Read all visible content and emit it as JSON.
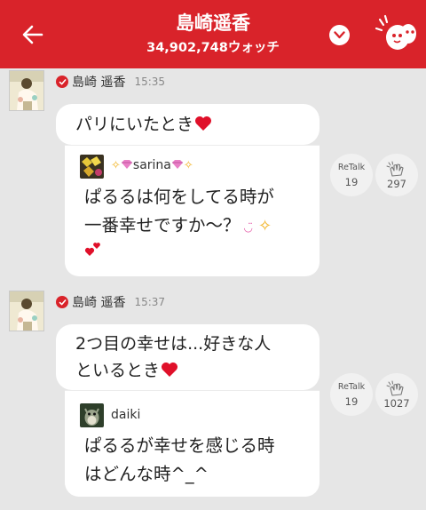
{
  "header": {
    "title": "島崎遥香",
    "subtitle": "34,902,748ウォッチ"
  },
  "posts": [
    {
      "author": "島崎 遥香",
      "time": "15:35",
      "message": "パリにいたとき",
      "quote": {
        "name": "sarina",
        "lines": [
          "ぱるるは何をしてる時が",
          "一番幸せですか〜？"
        ]
      },
      "retalk_label": "ReTalk",
      "retalk_count": "19",
      "clap_count": "297"
    },
    {
      "author": "島崎 遥香",
      "time": "15:37",
      "message_lines": [
        "2つ目の幸せは...好きな人",
        "といるとき"
      ],
      "quote": {
        "name": "daiki",
        "lines": [
          "ぱるるが幸せを感じる時",
          "はどんな時^_^"
        ]
      },
      "retalk_label": "ReTalk",
      "retalk_count": "19",
      "clap_count": "1027"
    }
  ],
  "colors": {
    "brand": "#d9232a",
    "background": "#e6e6e6",
    "heart": "#e0102a"
  },
  "icons": [
    "back-arrow-icon",
    "chevron-down-icon",
    "watch-face-icon",
    "verified-badge-icon",
    "heart-icon",
    "clap-hands-icon",
    "sparkle-icon",
    "gem-icon"
  ]
}
